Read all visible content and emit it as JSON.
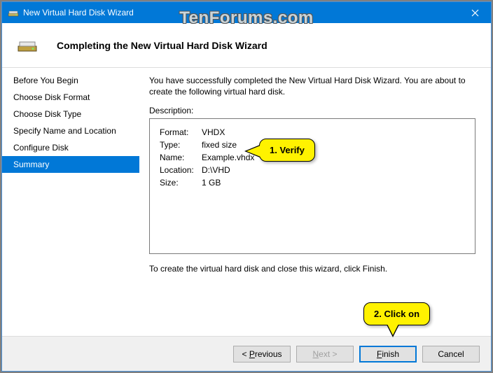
{
  "window": {
    "title": "New Virtual Hard Disk Wizard"
  },
  "header": {
    "title": "Completing the New Virtual Hard Disk Wizard"
  },
  "sidebar": {
    "items": [
      {
        "label": "Before You Begin"
      },
      {
        "label": "Choose Disk Format"
      },
      {
        "label": "Choose Disk Type"
      },
      {
        "label": "Specify Name and Location"
      },
      {
        "label": "Configure Disk"
      },
      {
        "label": "Summary"
      }
    ],
    "activeIndex": 5
  },
  "content": {
    "intro": "You have successfully completed the New Virtual Hard Disk Wizard. You are about to create the following virtual hard disk.",
    "descriptionLabel": "Description:",
    "desc": {
      "keys": {
        "format": "Format:",
        "type": "Type:",
        "name": "Name:",
        "location": "Location:",
        "size": "Size:"
      },
      "values": {
        "format": "VHDX",
        "type": "fixed size",
        "name": "Example.vhdx",
        "location": "D:\\VHD",
        "size": "1 GB"
      }
    },
    "instruction": "To create the virtual hard disk and close this wizard, click Finish."
  },
  "footer": {
    "previous": "< Previous",
    "next_prefix": "N",
    "next_suffix": "ext >",
    "finish_prefix": "F",
    "finish_suffix": "inish",
    "cancel": "Cancel"
  },
  "callouts": {
    "verify": "1. Verify",
    "clickon": "2. Click on"
  },
  "watermark": "TenForums.com"
}
